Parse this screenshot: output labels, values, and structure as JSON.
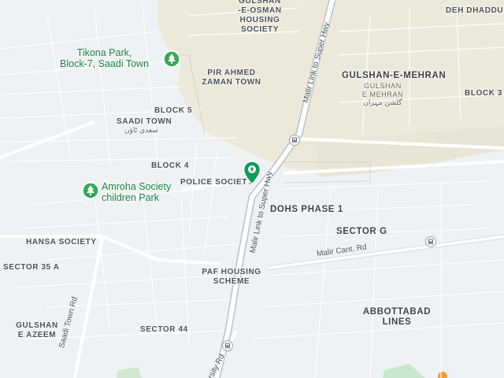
{
  "map": {
    "colors": {
      "background": "#eef2f4",
      "urban_area": "#ede9da",
      "major_road": "#ffffff",
      "highway_casing": "#b8c0c8",
      "park": "#c8e6c9",
      "poi_green": "#188038",
      "label": "#4a4e55"
    },
    "areas": [
      {
        "id": "gulshan-e-osman",
        "lines": [
          "GULSHAN",
          "-E-OSMAN",
          "HOUSING",
          "SOCIETY"
        ]
      },
      {
        "id": "deh-dhaddu",
        "lines": [
          "DEH DHADDU"
        ]
      },
      {
        "id": "pir-ahmed",
        "lines": [
          "PIR AHMED",
          "ZAMAN TOWN"
        ]
      },
      {
        "id": "gulshan-e-mehran",
        "lines": [
          "GULSHAN-E-MEHRAN"
        ]
      },
      {
        "id": "gulshan-e-mehran-small",
        "lines": [
          "GULSHAN",
          "E MEHRAN"
        ]
      },
      {
        "id": "gulshan-e-mehran-urdu",
        "lines": [
          "گلشن مہران"
        ]
      },
      {
        "id": "block-3",
        "lines": [
          "BLOCK 3"
        ]
      },
      {
        "id": "block-5",
        "lines": [
          "BLOCK 5"
        ]
      },
      {
        "id": "saadi-town",
        "lines": [
          "SAADI TOWN"
        ]
      },
      {
        "id": "saadi-town-urdu",
        "lines": [
          "سعدی ٹاؤن"
        ]
      },
      {
        "id": "block-4",
        "lines": [
          "BLOCK 4"
        ]
      },
      {
        "id": "police-society",
        "lines": [
          "POLICE SOCIETY"
        ]
      },
      {
        "id": "dohs-phase-1",
        "lines": [
          "DOHS PHASE 1"
        ]
      },
      {
        "id": "sector-g",
        "lines": [
          "SECTOR G"
        ]
      },
      {
        "id": "hansa-society",
        "lines": [
          "HANSA SOCIETY"
        ]
      },
      {
        "id": "sector-35-a",
        "lines": [
          "SECTOR 35 A"
        ]
      },
      {
        "id": "paf-housing",
        "lines": [
          "PAF HOUSING",
          "SCHEME"
        ]
      },
      {
        "id": "abbottabad-lines",
        "lines": [
          "ABBOTTABAD",
          "LINES"
        ]
      },
      {
        "id": "gulshan-e-azeem",
        "lines": [
          "GULSHAN",
          "E AZEEM"
        ]
      },
      {
        "id": "sector-44",
        "lines": [
          "SECTOR 44"
        ]
      }
    ],
    "roads": [
      {
        "id": "malir-link-north",
        "label": "Malir Link to Super Hwy"
      },
      {
        "id": "malir-link-south",
        "label": "Malir Link to Super Hwy"
      },
      {
        "id": "malir-cant-rd",
        "label": "Malir Cant. Rd"
      },
      {
        "id": "saadi-town-rd",
        "label": "Saadi Town Rd"
      },
      {
        "id": "university-rd",
        "label": "rsity Rd"
      }
    ],
    "pois": [
      {
        "id": "tikona-park",
        "lines": [
          "Tikona Park,",
          "Block-7, Saadi Town"
        ],
        "icon": "tree-icon"
      },
      {
        "id": "amroha-park",
        "lines": [
          "Amroha Society",
          "children Park"
        ],
        "icon": "tree-icon"
      }
    ],
    "selected_place": {
      "icon": "map-pin-icon"
    },
    "transit_stops": [
      {
        "id": "stop-1",
        "icon": "bus-stop-icon"
      },
      {
        "id": "stop-2",
        "icon": "bus-stop-icon"
      },
      {
        "id": "stop-3",
        "icon": "bus-stop-icon"
      }
    ]
  }
}
